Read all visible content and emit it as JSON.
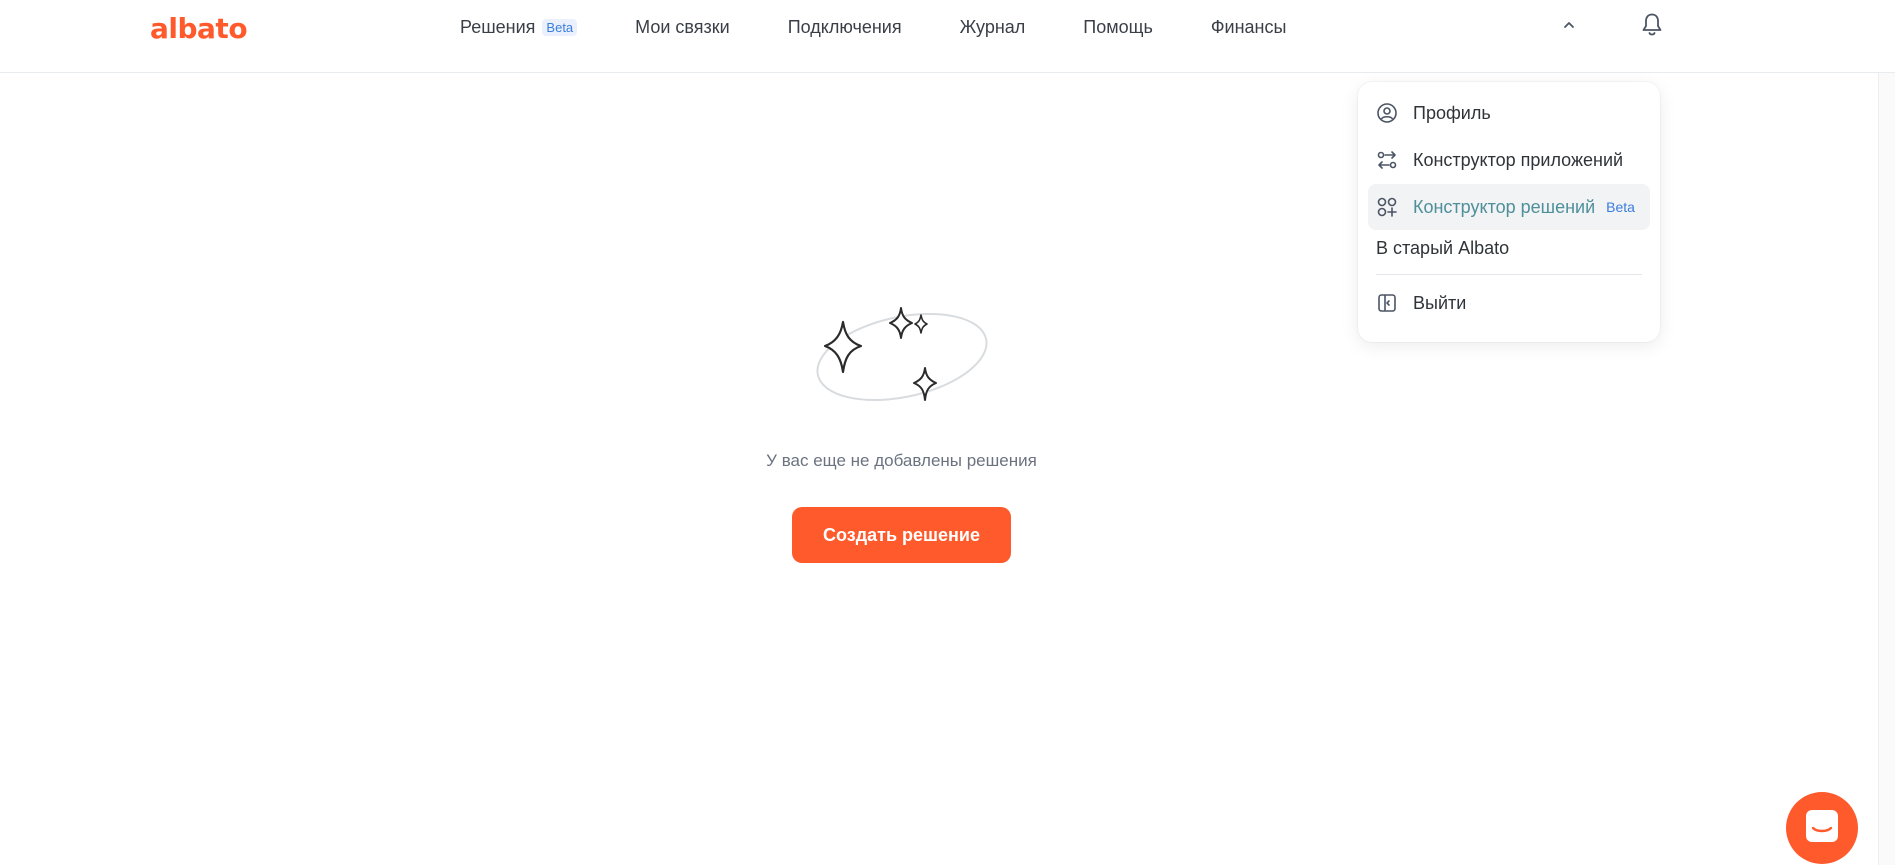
{
  "app": {
    "logo_text": "albato"
  },
  "nav": {
    "items": [
      {
        "label": "Решения",
        "badge": "Beta"
      },
      {
        "label": "Мои связки"
      },
      {
        "label": "Подключения"
      },
      {
        "label": "Журнал"
      },
      {
        "label": "Помощь"
      },
      {
        "label": "Финансы"
      }
    ]
  },
  "empty_state": {
    "message": "У вас еще не добавлены решения",
    "button_label": "Создать решение"
  },
  "user_menu": {
    "items": [
      {
        "label": "Профиль",
        "icon": "user-circle-icon"
      },
      {
        "label": "Конструктор приложений",
        "icon": "app-builder-icon"
      },
      {
        "label": "Конструктор решений",
        "badge": "Beta",
        "icon": "solutions-builder-icon",
        "active": true
      }
    ],
    "old_version": "В старый Albato",
    "logout": {
      "label": "Выйти",
      "icon": "logout-icon"
    }
  },
  "colors": {
    "accent": "#ff5a2c",
    "beta": "#3b7ddd",
    "active_text": "#4f8f9a"
  }
}
